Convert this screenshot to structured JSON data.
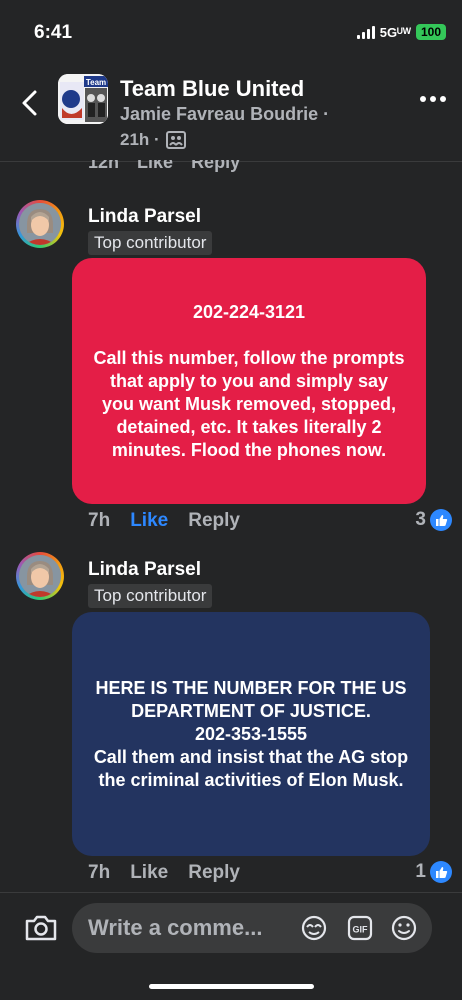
{
  "status": {
    "time": "6:41",
    "network": "5Gᵁᵂ",
    "battery": "100"
  },
  "header": {
    "group_name": "Team Blue United",
    "author": "Jamie Favreau Boudrie ·",
    "time": "21h ·",
    "group_avatar_text": "Team"
  },
  "previous_comment": {
    "time": "12h",
    "like_label": "Like",
    "reply_label": "Reply"
  },
  "comments": [
    {
      "name": "Linda Parsel",
      "badge": "Top contributor",
      "card_text": "202-224-3121\n\nCall this number, follow the prompts that apply to you and simply say you want Musk removed, stopped, detained, etc. It takes literally 2 minutes. Flood the phones now.",
      "card_color": "#e41e47",
      "time": "7h",
      "like_label": "Like",
      "liked": true,
      "reply_label": "Reply",
      "reactions": "3"
    },
    {
      "name": "Linda Parsel",
      "badge": "Top contributor",
      "card_text": "HERE IS THE NUMBER FOR THE US DEPARTMENT OF JUSTICE.\n202-353-1555\nCall them and insist that the AG stop the criminal activities of Elon Musk.",
      "card_color": "#233460",
      "time": "7h",
      "like_label": "Like",
      "liked": false,
      "reply_label": "Reply",
      "reactions": "1"
    }
  ],
  "composer": {
    "placeholder": "Write a comme...",
    "gif_label": "GIF",
    "icons": [
      "camera-icon",
      "avatar-sticker-icon",
      "gif-icon",
      "emoji-icon"
    ]
  },
  "colors": {
    "background": "#242526",
    "accent": "#2d88ff",
    "muted_text": "#b0b3b8"
  }
}
